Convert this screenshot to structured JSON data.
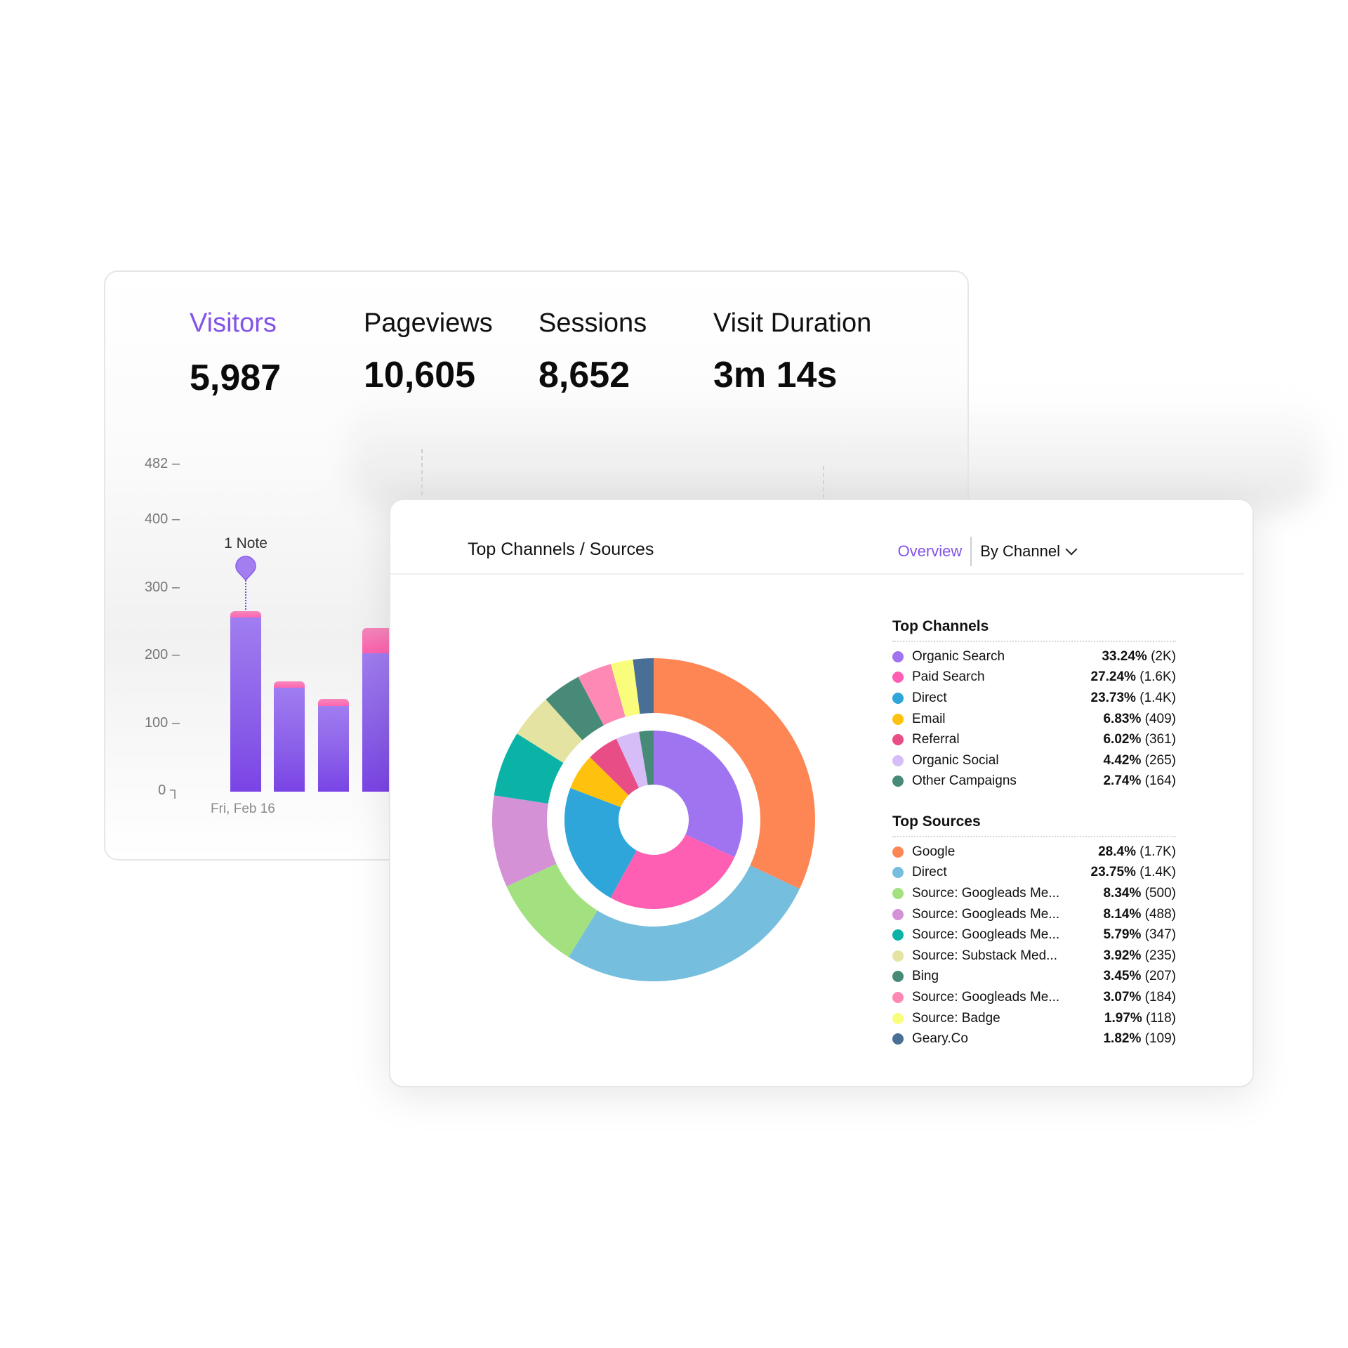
{
  "metrics": [
    {
      "label": "Visitors",
      "value": "5,987",
      "active": true
    },
    {
      "label": "Pageviews",
      "value": "10,605",
      "active": false
    },
    {
      "label": "Sessions",
      "value": "8,652",
      "active": false
    },
    {
      "label": "Visit Duration",
      "value": "3m 14s",
      "active": false
    }
  ],
  "visitors_chart": {
    "type": "bar",
    "y_ticks": [
      "482",
      "400",
      "300",
      "200",
      "100",
      "0"
    ],
    "y_max": 482,
    "x_label_first": "Fri, Feb 16",
    "note_label": "1 Note",
    "bars": [
      {
        "base": 257,
        "top": 266
      },
      {
        "base": 153,
        "top": 163
      },
      {
        "base": 126,
        "top": 137
      },
      {
        "base": 204,
        "top": 241
      }
    ],
    "colors": {
      "base": "#8a5ee8",
      "top": "#ff6fb5",
      "note": "#a27ef0"
    }
  },
  "panel": {
    "title": "Top Channels / Sources",
    "tab_overview": "Overview",
    "dropdown_label": "By Channel",
    "accent": "#8354e8"
  },
  "chart_data": {
    "type": "pie",
    "title": "Top Channels / Sources",
    "inner_ring": {
      "title": "Top Channels",
      "items": [
        {
          "label": "Organic Search",
          "pct": 33.24,
          "pct_text": "33.24%",
          "count": "(2K)",
          "color": "#a074f0"
        },
        {
          "label": "Paid Search",
          "pct": 27.24,
          "pct_text": "27.24%",
          "count": "(1.6K)",
          "color": "#ff5fb3"
        },
        {
          "label": "Direct",
          "pct": 23.73,
          "pct_text": "23.73%",
          "count": "(1.4K)",
          "color": "#2fa6d9"
        },
        {
          "label": "Email",
          "pct": 6.83,
          "pct_text": "6.83%",
          "count": "(409)",
          "color": "#fdc10e"
        },
        {
          "label": "Referral",
          "pct": 6.02,
          "pct_text": "6.02%",
          "count": "(361)",
          "color": "#e84d86"
        },
        {
          "label": "Organic Social",
          "pct": 4.42,
          "pct_text": "4.42%",
          "count": "(265)",
          "color": "#d6bdf7"
        },
        {
          "label": "Other Campaigns",
          "pct": 2.74,
          "pct_text": "2.74%",
          "count": "(164)",
          "color": "#478a78"
        }
      ]
    },
    "outer_ring": {
      "title": "Top Sources",
      "items": [
        {
          "label": "Google",
          "pct": 28.4,
          "pct_text": "28.4%",
          "count": "(1.7K)",
          "color": "#fd8654"
        },
        {
          "label": "Direct",
          "pct": 23.75,
          "pct_text": "23.75%",
          "count": "(1.4K)",
          "color": "#76bedd"
        },
        {
          "label": "Source: Googleads Me...",
          "pct": 8.34,
          "pct_text": "8.34%",
          "count": "(500)",
          "color": "#a3e080"
        },
        {
          "label": "Source: Googleads Me...",
          "pct": 8.14,
          "pct_text": "8.14%",
          "count": "(488)",
          "color": "#d591d6"
        },
        {
          "label": "Source: Googleads Me...",
          "pct": 5.79,
          "pct_text": "5.79%",
          "count": "(347)",
          "color": "#0ab3a6"
        },
        {
          "label": "Source: Substack Med...",
          "pct": 3.92,
          "pct_text": "3.92%",
          "count": "(235)",
          "color": "#e4e3a2"
        },
        {
          "label": "Bing",
          "pct": 3.45,
          "pct_text": "3.45%",
          "count": "(207)",
          "color": "#478a78"
        },
        {
          "label": "Source: Googleads Me...",
          "pct": 3.07,
          "pct_text": "3.07%",
          "count": "(184)",
          "color": "#fd89b4"
        },
        {
          "label": "Source: Badge",
          "pct": 1.97,
          "pct_text": "1.97%",
          "count": "(118)",
          "color": "#fafd7c"
        },
        {
          "label": "Geary.Co",
          "pct": 1.82,
          "pct_text": "1.82%",
          "count": "(109)",
          "color": "#4a6f96"
        }
      ]
    }
  }
}
